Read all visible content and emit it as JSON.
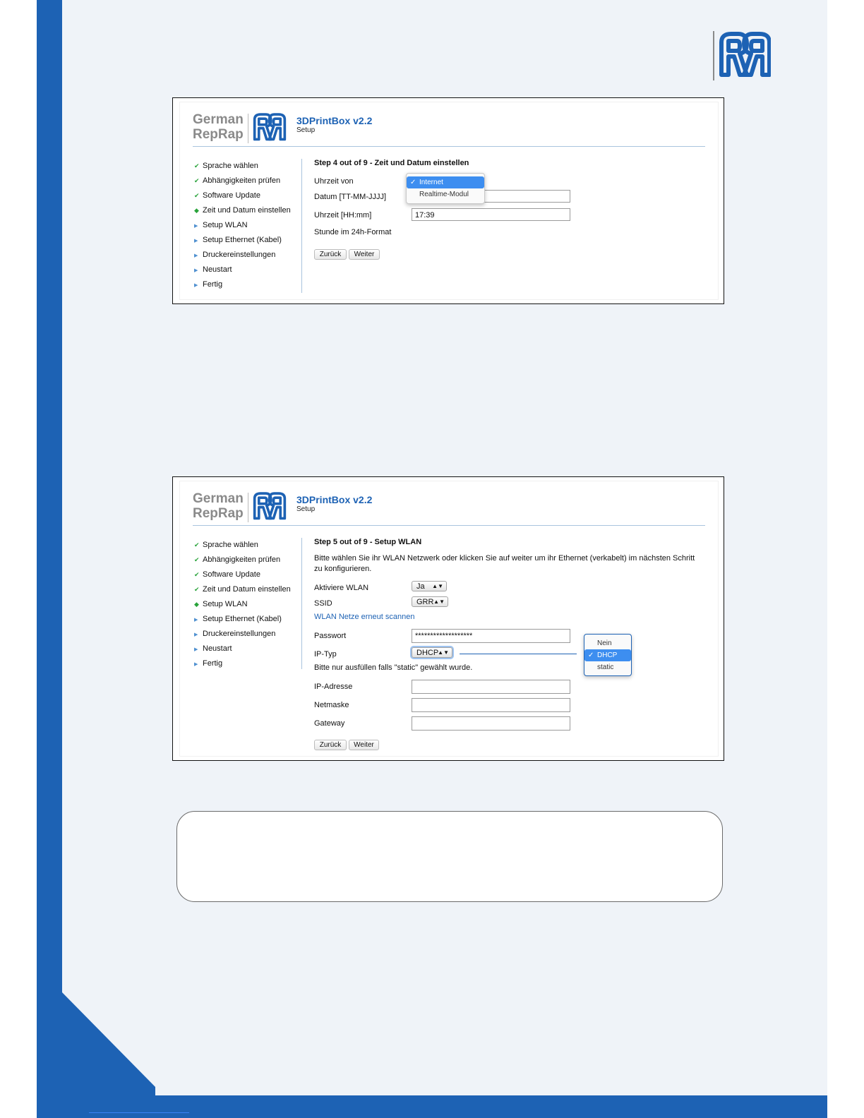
{
  "app": {
    "title": "3DPrintBox v2.2",
    "subtitle": "Setup",
    "brand_line1": "German",
    "brand_line2": "RepRap"
  },
  "nav": [
    "Sprache wählen",
    "Abhängigkeiten prüfen",
    "Software Update",
    "Zeit und Datum einstellen",
    "Setup WLAN",
    "Setup Ethernet (Kabel)",
    "Druckereinstellungen",
    "Neustart",
    "Fertig"
  ],
  "buttons": {
    "back": "Zurück",
    "next": "Weiter"
  },
  "step4": {
    "title": "Step 4 out of 9 - Zeit und Datum einstellen",
    "time_source_label": "Uhrzeit von",
    "date_label": "Datum [TT-MM-JJJJ]",
    "date_value": "",
    "time_label": "Uhrzeit [HH:mm]",
    "time_value": "17:39",
    "hint": "Stunde im 24h-Format",
    "dropdown_options": [
      "Internet",
      "Realtime-Modul"
    ],
    "dropdown_selected": "Internet"
  },
  "step5": {
    "title": "Step 5 out of 9 - Setup WLAN",
    "intro": "Bitte wählen Sie ihr WLAN Netzwerk oder klicken Sie auf weiter um ihr Ethernet (verkabelt) im nächsten Schritt zu konfigurieren.",
    "wlan_label": "Aktiviere WLAN",
    "wlan_value": "Ja",
    "ssid_label": "SSID",
    "ssid_value": "GRR",
    "rescan_link": "WLAN Netze erneut scannen",
    "password_label": "Passwort",
    "password_value": "*******************",
    "iptype_label": "IP-Typ",
    "iptype_value": "DHCP",
    "static_hint": "Bitte nur ausfüllen falls \"static\" gewählt wurde.",
    "ip_label": "IP-Adresse",
    "netmask_label": "Netmaske",
    "gateway_label": "Gateway",
    "iptype_options": [
      "Nein",
      "DHCP",
      "static"
    ],
    "iptype_selected": "DHCP"
  },
  "colors": {
    "brand_blue": "#1d62b4",
    "page_bg": "#eff3f8",
    "check_green": "#28a33a",
    "select_blue": "#3d8ef0"
  },
  "icons": {
    "done": "check-icon",
    "current": "diamond-icon",
    "todo": "triangle-right-icon"
  }
}
